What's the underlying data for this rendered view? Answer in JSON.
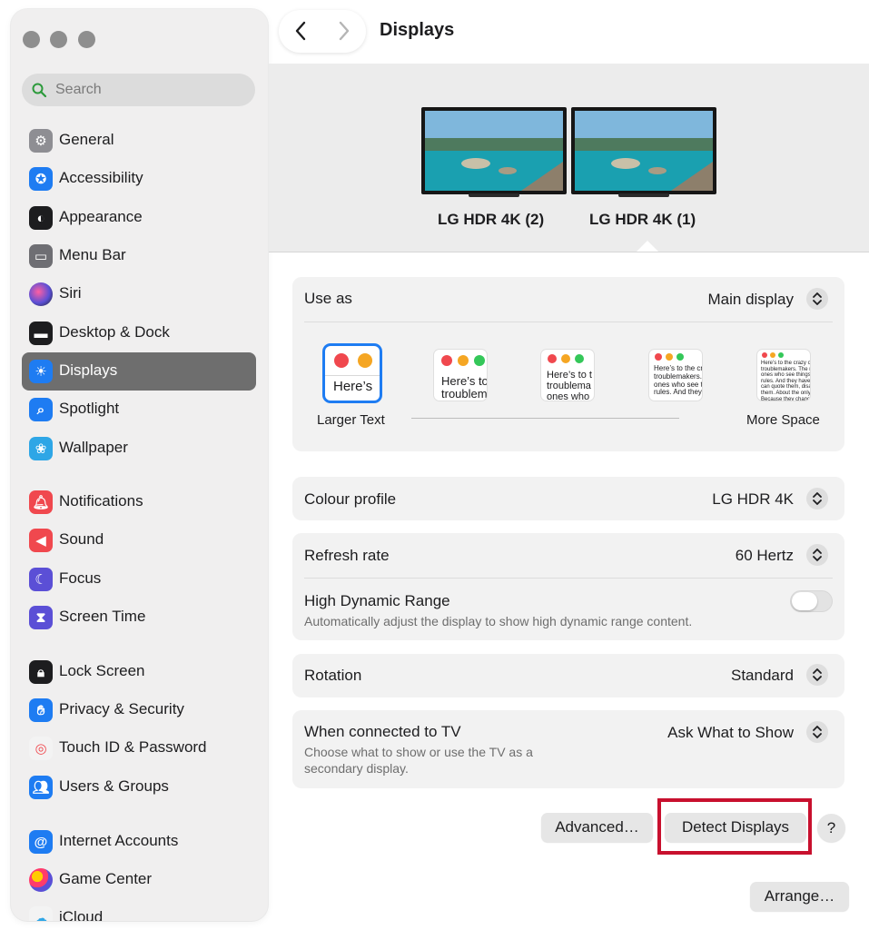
{
  "window": {
    "title": "Displays"
  },
  "sidebar": {
    "search_placeholder": "Search",
    "items": [
      {
        "label": "General",
        "icon": "gear-icon",
        "color": "#8e8e93"
      },
      {
        "label": "Accessibility",
        "icon": "accessibility-icon",
        "color": "#1e7cf2"
      },
      {
        "label": "Appearance",
        "icon": "appearance-icon",
        "color": "#1d1d1f"
      },
      {
        "label": "Menu Bar",
        "icon": "menu-bar-icon",
        "color": "#6e6e73"
      },
      {
        "label": "Siri",
        "icon": "siri-icon",
        "color": "#7a3cd6"
      },
      {
        "label": "Desktop & Dock",
        "icon": "dock-icon",
        "color": "#1d1d1f"
      },
      {
        "label": "Displays",
        "icon": "sun-icon",
        "color": "#1e7cf2",
        "selected": true
      },
      {
        "label": "Spotlight",
        "icon": "magnifier-icon",
        "color": "#1e7cf2"
      },
      {
        "label": "Wallpaper",
        "icon": "flower-icon",
        "color": "#2ea6e6"
      },
      {
        "label": "Notifications",
        "icon": "bell-icon",
        "color": "#f0484e"
      },
      {
        "label": "Sound",
        "icon": "speaker-icon",
        "color": "#f0484e"
      },
      {
        "label": "Focus",
        "icon": "moon-icon",
        "color": "#5b4fd6"
      },
      {
        "label": "Screen Time",
        "icon": "hourglass-icon",
        "color": "#5b4fd6"
      },
      {
        "label": "Lock Screen",
        "icon": "lock-icon",
        "color": "#1d1d1f"
      },
      {
        "label": "Privacy & Security",
        "icon": "hand-icon",
        "color": "#1e7cf2"
      },
      {
        "label": "Touch ID & Password",
        "icon": "fingerprint-icon",
        "color": "#f3f3f3"
      },
      {
        "label": "Users & Groups",
        "icon": "users-icon",
        "color": "#1e7cf2"
      },
      {
        "label": "Internet Accounts",
        "icon": "at-icon",
        "color": "#1e7cf2"
      },
      {
        "label": "Game Center",
        "icon": "game-center-icon",
        "color": "#f3f3f3"
      },
      {
        "label": "iCloud",
        "icon": "cloud-icon",
        "color": "#f3f3f3"
      }
    ]
  },
  "displays": [
    {
      "label": "LG HDR 4K (2)",
      "selected": false
    },
    {
      "label": "LG HDR 4K (1)",
      "selected": true
    }
  ],
  "use_as": {
    "label": "Use as",
    "value": "Main display"
  },
  "resolution": {
    "left_label": "Larger Text",
    "right_label": "More Space",
    "options": [
      {
        "text": "Here’s",
        "selected": true
      },
      {
        "text": "Here’s to t\ntroublem"
      },
      {
        "text": "Here’s to t\ntroublema\nones who"
      },
      {
        "text": "Here’s to the cr\ntroublemakers.\nones who see t\nrules. And they"
      },
      {
        "text": "Here’s to the crazy one\ntroublemakers. The rou\nones who see things dif\nrules. And they have no\ncan quote them, disagr\nthem. About the only th\nBecause they change th"
      }
    ]
  },
  "colour_profile": {
    "label": "Colour profile",
    "value": "LG HDR 4K"
  },
  "refresh_rate": {
    "label": "Refresh rate",
    "value": "60 Hertz"
  },
  "hdr": {
    "label": "High Dynamic Range",
    "description": "Automatically adjust the display to show high dynamic range content.",
    "on": false
  },
  "rotation": {
    "label": "Rotation",
    "value": "Standard"
  },
  "tv": {
    "label": "When connected to TV",
    "description_line1": "Choose what to show or use the TV as a",
    "description_line2": "secondary display.",
    "value": "Ask What to Show"
  },
  "buttons": {
    "advanced": "Advanced…",
    "detect": "Detect Displays",
    "help": "?",
    "arrange": "Arrange…"
  },
  "colors": {
    "accent": "#1e7cf2",
    "highlight": "#c8102e",
    "selected_row": "#6e6e6e"
  }
}
